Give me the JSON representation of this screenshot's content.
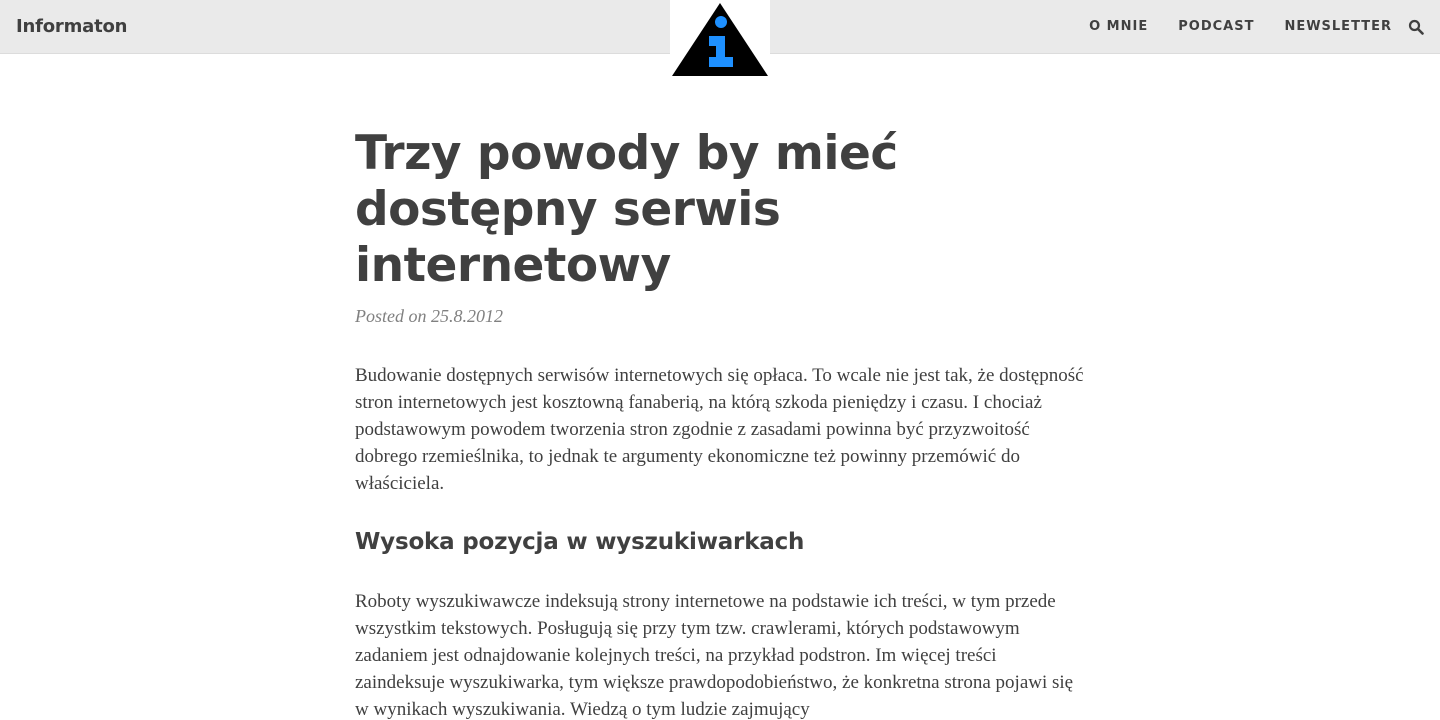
{
  "navbar": {
    "brand": "Informaton",
    "links": [
      "O MNIE",
      "PODCAST",
      "NEWSLETTER"
    ],
    "logo_icon": "info-triangle-logo",
    "search_icon": "search-icon",
    "colors": {
      "background": "#eaeaea",
      "text": "#404040",
      "logo_triangle": "#000000",
      "logo_info": "#1e90ff"
    }
  },
  "post": {
    "title": "Trzy powody by mieć dostępny serwis internetowy",
    "meta": "Posted on 25.8.2012",
    "intro": "Budowanie dostępnych serwisów internetowych się opłaca. To wcale nie jest tak, że dostępność stron internetowych jest kosztowną fanaberią, na którą szkoda pieniędzy i czasu. I chociaż podstawowym powodem tworzenia stron zgodnie z zasadami powinna być przyzwoitość dobrego rzemieślnika, to jednak te argumenty ekonomiczne też powinny przemówić do właściciela.",
    "section_heading": "Wysoka pozycja w wyszukiwarkach",
    "section_para": "Roboty wyszukiwawcze indeksują strony internetowe na podstawie ich treści, w tym przede wszystkim tekstowych. Posługują się przy tym tzw. crawlerami, których podstawowym zadaniem jest odnajdowanie kolejnych treści, na przykład podstron. Im więcej treści zaindeksuje wyszukiwarka, tym większe prawdopodobieństwo, że konkretna strona pojawi się w wynikach wyszukiwania. Wiedzą o tym ludzie zajmujący"
  }
}
